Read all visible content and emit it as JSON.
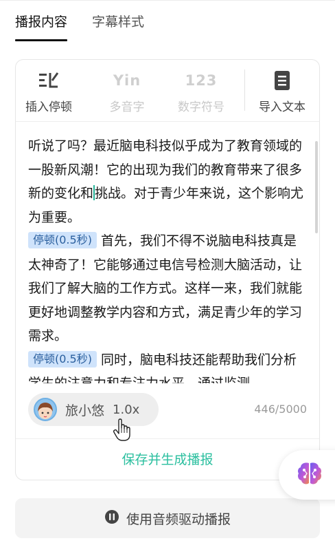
{
  "tabs": [
    {
      "label": "播报内容",
      "active": true
    },
    {
      "label": "字幕样式",
      "active": false
    }
  ],
  "toolbar": {
    "insert_pause": {
      "label": "插入停顿",
      "icon": "insert-pause-icon"
    },
    "polyphone": {
      "label": "多音字",
      "icon_text": "Yin"
    },
    "number_symbol": {
      "label": "数字符号",
      "icon_text": "123"
    },
    "import_text": {
      "label": "导入文本",
      "icon": "document-icon"
    }
  },
  "editor": {
    "para1_before_caret": "听说了吗？最近脑电科技似乎成为了教育领域的一股新风潮！它的出现为我们的教育带来了很多新的变化和",
    "para1_after_caret": "挑战。对于青少年来说，这个影响尤为重要。",
    "pause_label": "停顿(0.5秒)",
    "para2": "首先，我们不得不说脑电科技真是太神奇了！它能够通过电信号检测大脑活动，让我们了解大脑的工作方式。这样一来，我们就能更好地调整教学内容和方式，满足青少年的学习需求。",
    "para3": "同时，脑电科技还能帮助我们分析学生的注意力和专注力水平。通过监测"
  },
  "voice": {
    "name": "旅小悠",
    "speed": "1.0x"
  },
  "char_count": "446/5000",
  "save_button": "保存并生成播报",
  "audio_driven_button": "使用音频驱动播报",
  "colors": {
    "accent": "#2bbf9f",
    "pause_tag_bg": "#cfe3fb",
    "pause_tag_text": "#2a5f9e"
  }
}
